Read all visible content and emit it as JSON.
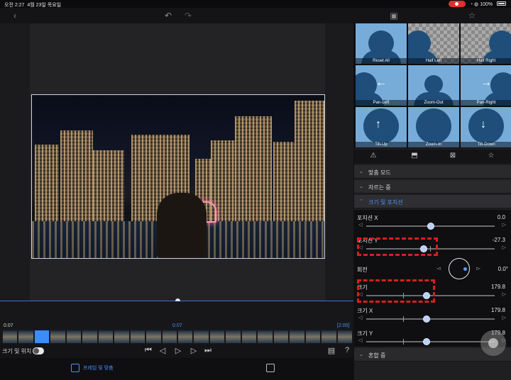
{
  "status_bar": {
    "time": "오전 2:27",
    "date": "4월 23일 목요일",
    "battery": "100%"
  },
  "icons": {
    "back": "chevron-left-icon",
    "undo": "undo-icon",
    "redo": "redo-icon",
    "crop_frame": "frame-icon",
    "favorite": "star-icon"
  },
  "timeline": {
    "left_time": "0.07",
    "center_time": "0.07",
    "right_time": "[2.00]"
  },
  "transport": {
    "mode_label": "크기 및 위치"
  },
  "bottom_tabs": {
    "frame_fit": "프레임 및 맞춤"
  },
  "presets": [
    {
      "label": "Reset All",
      "arrow": ""
    },
    {
      "label": "Half Left",
      "arrow": ""
    },
    {
      "label": "Half Right",
      "arrow": ""
    },
    {
      "label": "Pan-Left",
      "arrow": "←"
    },
    {
      "label": "Zoom-Out",
      "arrow": ""
    },
    {
      "label": "Pan-Right",
      "arrow": "→"
    },
    {
      "label": "Tilt-Up",
      "arrow": "↑"
    },
    {
      "label": "Zoom-In",
      "arrow": ""
    },
    {
      "label": "Tilt-Down",
      "arrow": "↓"
    }
  ],
  "sections": {
    "fit_mode": "맞춤 모드",
    "cropping": "자르는 중",
    "size_position": "크기 및 포지션",
    "blending": "혼합 중"
  },
  "properties": {
    "position_x": {
      "label": "포지션 X",
      "value": "0.0",
      "level": 0.5
    },
    "position_y": {
      "label": "포지션 Y",
      "value": "-27.3",
      "level": 0.45
    },
    "rotation": {
      "label": "회전",
      "value": "0.0°"
    },
    "size": {
      "label": "크기",
      "value": "179.8",
      "level": 0.47
    },
    "size_x": {
      "label": "크기 X",
      "value": "179.8",
      "level": 0.47
    },
    "size_y": {
      "label": "크기 Y",
      "value": "179.8",
      "level": 0.47
    }
  },
  "accent_color": "#4d8dff",
  "highlight_color": "#d32020"
}
